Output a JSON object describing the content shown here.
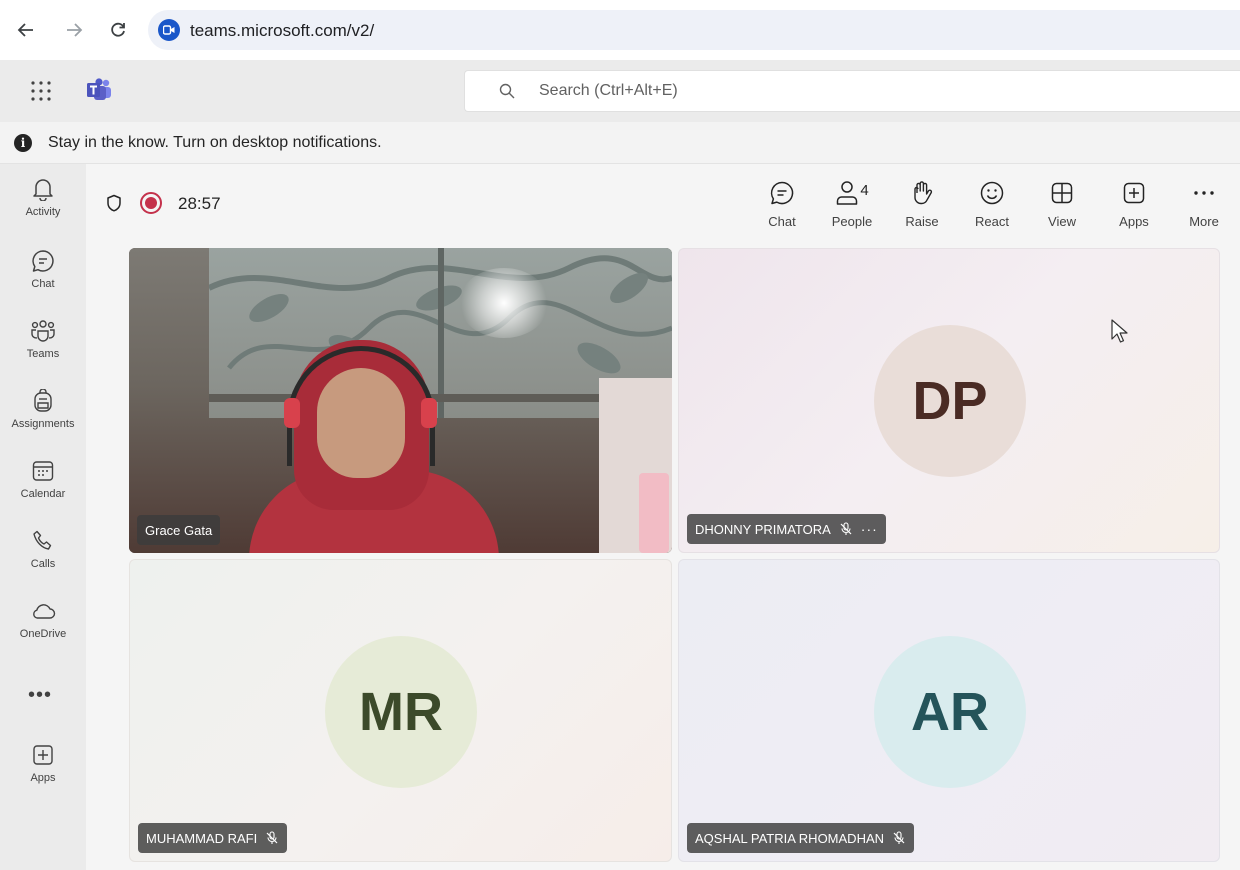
{
  "browser": {
    "url": "teams.microsoft.com/v2/"
  },
  "header": {
    "search_placeholder": "Search (Ctrl+Alt+E)"
  },
  "notification": {
    "text": "Stay in the know. Turn on desktop notifications."
  },
  "rail": {
    "items": [
      {
        "label": "Activity",
        "icon": "bell-icon"
      },
      {
        "label": "Chat",
        "icon": "chat-icon"
      },
      {
        "label": "Teams",
        "icon": "teams-icon"
      },
      {
        "label": "Assignments",
        "icon": "backpack-icon"
      },
      {
        "label": "Calendar",
        "icon": "calendar-icon"
      },
      {
        "label": "Calls",
        "icon": "phone-icon"
      },
      {
        "label": "OneDrive",
        "icon": "cloud-icon"
      }
    ],
    "more": "•••",
    "apps_label": "Apps"
  },
  "meeting": {
    "timer": "28:57",
    "people_count": "4",
    "toolbar": {
      "chat": "Chat",
      "people": "People",
      "raise": "Raise",
      "react": "React",
      "view": "View",
      "apps": "Apps",
      "more": "More"
    }
  },
  "participants": [
    {
      "name": "Grace Gata",
      "initials": "",
      "video": true
    },
    {
      "name": "DHONNY PRIMATORA",
      "initials": "DP",
      "muted": true
    },
    {
      "name": "MUHAMMAD RAFI",
      "initials": "MR",
      "muted": true
    },
    {
      "name": "AQSHAL PATRIA RHOMADHAN",
      "initials": "AR",
      "muted": true
    }
  ],
  "colors": {
    "brand": "#5b5fc7",
    "recording": "#c4314b",
    "browser_site_icon": "#1a57c9"
  }
}
